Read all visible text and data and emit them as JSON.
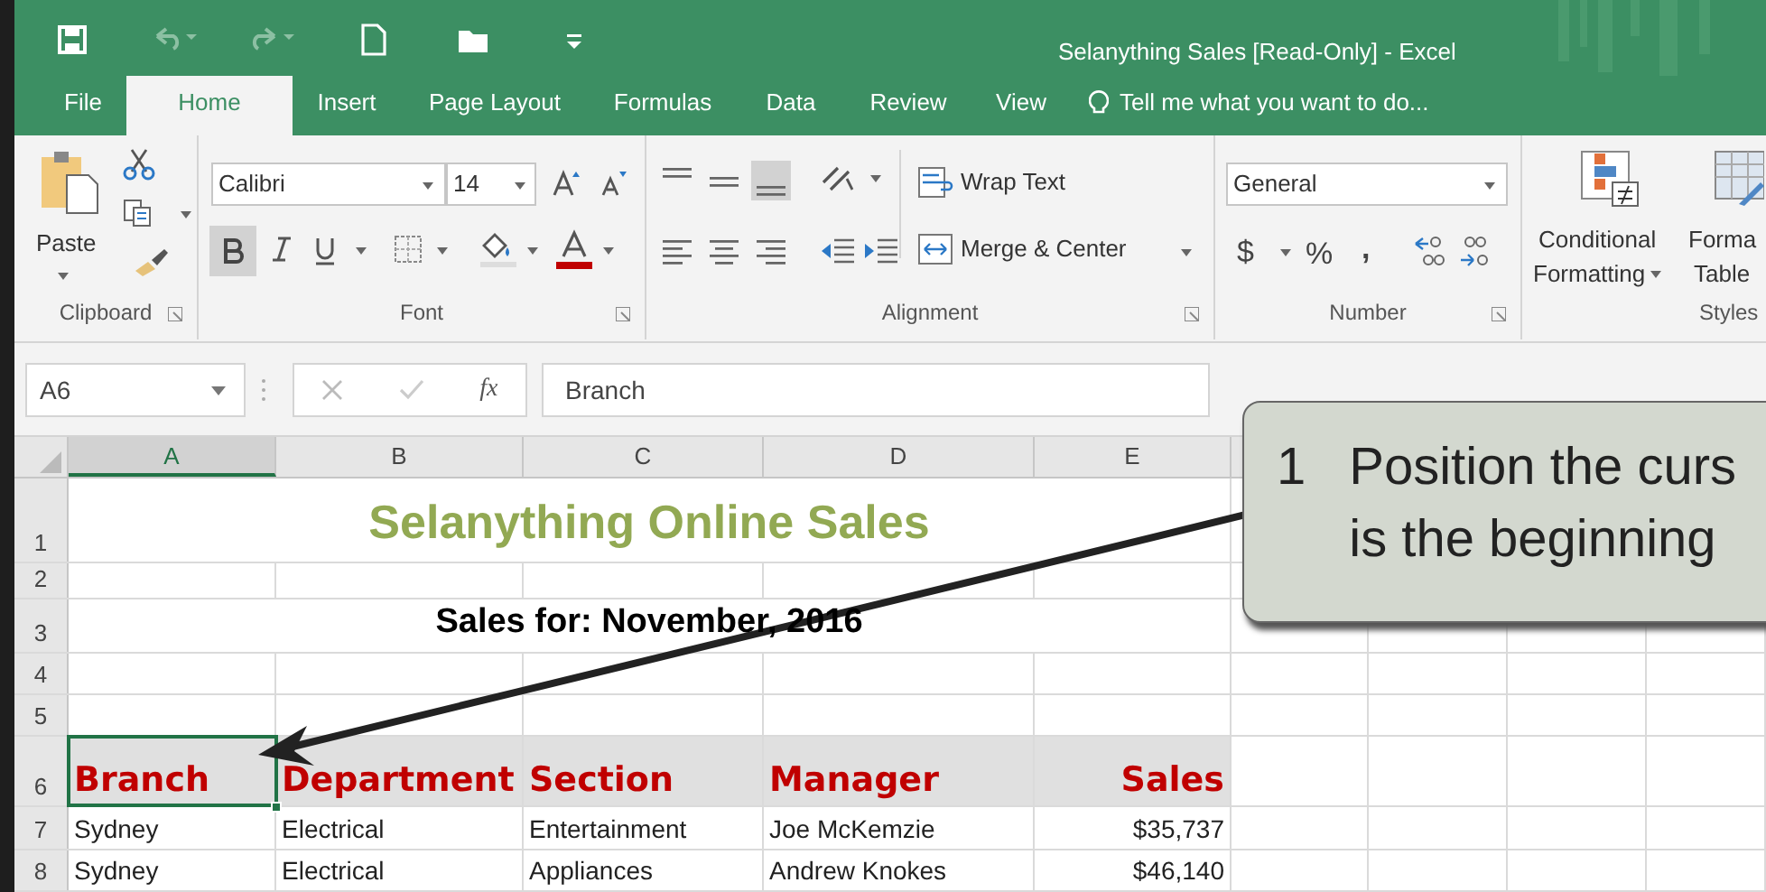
{
  "window": {
    "title": "Selanything Sales  [Read-Only] - Excel"
  },
  "tabs": [
    {
      "label": "File",
      "selected": false
    },
    {
      "label": "Home",
      "selected": true
    },
    {
      "label": "Insert",
      "selected": false
    },
    {
      "label": "Page Layout",
      "selected": false
    },
    {
      "label": "Formulas",
      "selected": false
    },
    {
      "label": "Data",
      "selected": false
    },
    {
      "label": "Review",
      "selected": false
    },
    {
      "label": "View",
      "selected": false
    }
  ],
  "tell_me": {
    "placeholder": "Tell me what you want to do..."
  },
  "ribbon": {
    "clipboard": {
      "paste": "Paste",
      "label": "Clipboard"
    },
    "font": {
      "name": "Calibri",
      "size": "14",
      "bold": true,
      "label": "Font"
    },
    "alignment": {
      "wrap_text": "Wrap Text",
      "merge": "Merge & Center",
      "label": "Alignment"
    },
    "number": {
      "format": "General",
      "currency": "$",
      "percent": "%",
      "comma": ",",
      "label": "Number"
    },
    "styles": {
      "conditional": [
        "Conditional",
        "Formatting"
      ],
      "format_table": [
        "Forma",
        "Table"
      ],
      "label": "Styles"
    }
  },
  "formula_bar": {
    "name_box": "A6",
    "fx": "fx",
    "value": "Branch"
  },
  "columns": [
    {
      "letter": "A",
      "selected": true
    },
    {
      "letter": "B",
      "selected": false
    },
    {
      "letter": "C",
      "selected": false
    },
    {
      "letter": "D",
      "selected": false
    },
    {
      "letter": "E",
      "selected": false,
      "kind": "currency"
    }
  ],
  "rows": [
    {
      "number": "1",
      "kind": "title",
      "text": "Selanything Online Sales"
    },
    {
      "number": "2",
      "kind": "blank"
    },
    {
      "number": "3",
      "kind": "subtitle",
      "text": "Sales for: November, 2016"
    },
    {
      "number": "4",
      "kind": "blank"
    },
    {
      "number": "5",
      "kind": "blank"
    },
    {
      "number": "6",
      "kind": "header",
      "cells": [
        {
          "text": "Branch",
          "selected": true
        },
        {
          "text": "Department",
          "selected": false
        },
        {
          "text": "Section",
          "selected": false
        },
        {
          "text": "Manager",
          "selected": false
        },
        {
          "text": "Sales",
          "selected": false
        }
      ]
    },
    {
      "number": "7",
      "kind": "data",
      "cells": [
        {
          "text": "Sydney",
          "selected": false
        },
        {
          "text": "Electrical",
          "selected": false
        },
        {
          "text": "Entertainment",
          "selected": false
        },
        {
          "text": "Joe McKemzie",
          "selected": false
        },
        {
          "text": "$35,737",
          "selected": false
        }
      ]
    },
    {
      "number": "8",
      "kind": "data",
      "cells": [
        {
          "text": "Sydney",
          "selected": false
        },
        {
          "text": "Electrical",
          "selected": false
        },
        {
          "text": "Appliances",
          "selected": false
        },
        {
          "text": "Andrew Knokes",
          "selected": false
        },
        {
          "text": "$46,140",
          "selected": false
        }
      ]
    }
  ],
  "callout": {
    "number": "1",
    "lines": [
      "Position the curs",
      "is the beginning"
    ]
  }
}
